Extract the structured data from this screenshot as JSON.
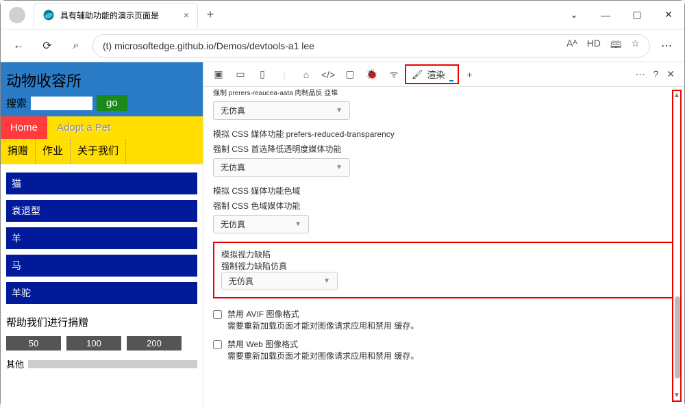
{
  "tab": {
    "title": "具有辅助功能的演示页面是",
    "close": "×",
    "newtab": "+"
  },
  "win": {
    "min": "—",
    "max": "▢",
    "close": "✕"
  },
  "toolbar": {
    "back": "←",
    "refresh": "⟳",
    "search": "⌕",
    "url": "(t) microsoftedge.github.io/Demos/devtools-a1 lee",
    "aa": "Aᴬ",
    "hd": "HD",
    "read": "🕮",
    "star": "☆",
    "more": "⋯"
  },
  "page": {
    "title": "动物收容所",
    "search_label": "搜索",
    "go": "go",
    "nav": {
      "home": "Home",
      "adopt": "Adopt a Pet",
      "donate": "捐赠",
      "jobs": "作业",
      "about": "关于我们"
    },
    "animals": [
      "猫",
      "衰退型",
      "羊",
      "马",
      "羊驼"
    ],
    "donate_title": "帮助我们进行捐赠",
    "donate_btns": [
      "50",
      "100",
      "200"
    ],
    "other": "其他"
  },
  "dev": {
    "tabs": {
      "render_label": "渲染",
      "plus": "+"
    },
    "right": {
      "dots": "⋯",
      "help": "?",
      "close": "✕"
    },
    "s0": {
      "l2": "强制 prerers-reaucea-aata 肉制品反 亞堆",
      "dd": "无仿真"
    },
    "s1": {
      "l1": "模拟 CSS 媒体功能 prefers-reduced-transparency",
      "l2": "强制 CSS 首选降低透明度媒体功能",
      "dd": "无仿真"
    },
    "s2": {
      "l1": "模拟 CSS 媒体功能色域",
      "l2": "强制 CSS 色域媒体功能",
      "dd": "无仿真"
    },
    "s3": {
      "l1": "模拟视力缺陷",
      "l2": "强制视力缺陷仿真",
      "dd": "无仿真"
    },
    "c1": {
      "l1": "禁用 AVIF 图像格式",
      "l2": "需要重新加载页面才能对图像请求应用和禁用 缓存。"
    },
    "c2": {
      "l1": "禁用 Web 图像格式",
      "l2": "需要重新加载页面才能对图像请求应用和禁用 缓存。"
    }
  }
}
